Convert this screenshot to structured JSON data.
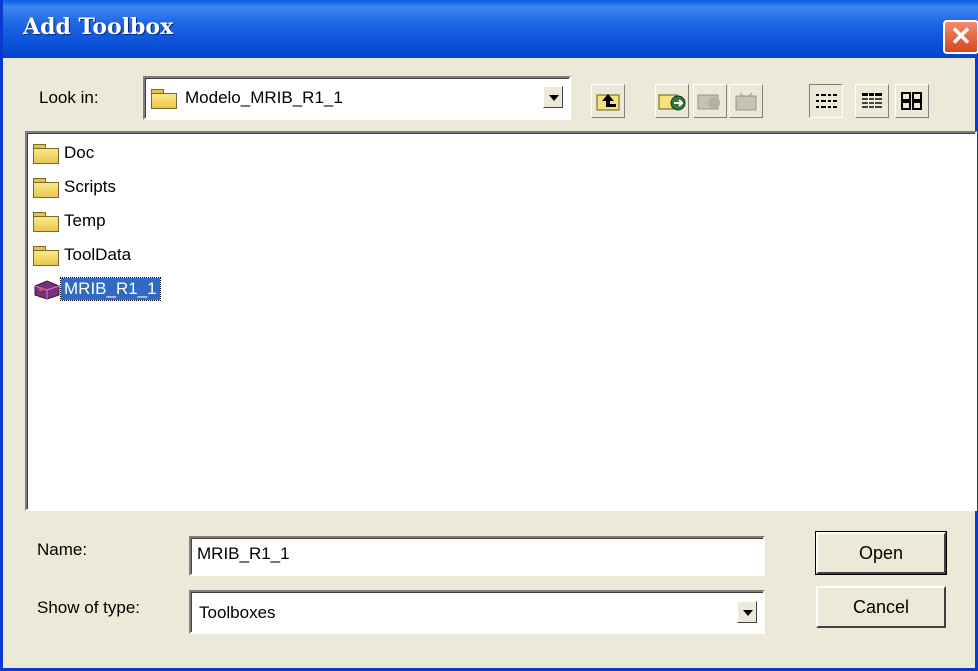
{
  "window": {
    "title": "Add Toolbox",
    "close_glyph": "✕"
  },
  "lookin": {
    "label": "Look in:",
    "value": "Modelo_MRIB_R1_1"
  },
  "toolbar": {
    "up_icon": "up-one-level-icon",
    "connect_icon": "connect-folder-icon",
    "disconnect_icon": "disconnect-folder-icon",
    "new_icon": "new-item-icon",
    "list_view_icon": "list-view-icon",
    "details_view_icon": "details-view-icon",
    "thumbnails_icon": "thumbnails-icon"
  },
  "files": [
    {
      "name": "Doc",
      "type": "folder"
    },
    {
      "name": "Scripts",
      "type": "folder"
    },
    {
      "name": "Temp",
      "type": "folder"
    },
    {
      "name": "ToolData",
      "type": "folder"
    },
    {
      "name": "MRIB_R1_1",
      "type": "toolbox",
      "selected": true
    }
  ],
  "name_field": {
    "label": "Name:",
    "value": "MRIB_R1_1"
  },
  "type_field": {
    "label": "Show of type:",
    "value": "Toolboxes"
  },
  "buttons": {
    "open": "Open",
    "cancel": "Cancel"
  },
  "colors": {
    "titlebar": "#0a4fd6",
    "selection": "#316ac5",
    "dialog_bg": "#ece9d8"
  }
}
